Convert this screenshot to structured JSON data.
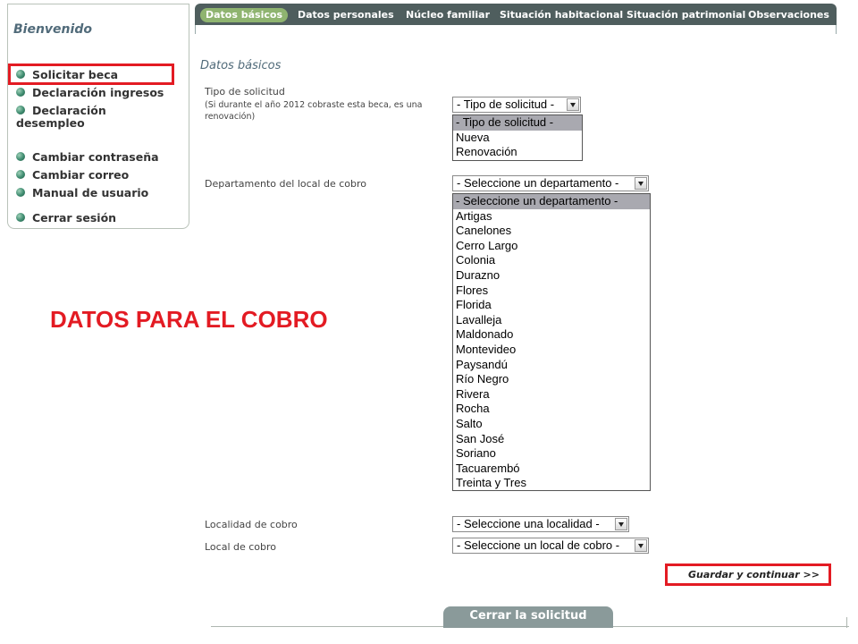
{
  "sidebar": {
    "title": "Bienvenido",
    "items": [
      {
        "label": "Solicitar beca"
      },
      {
        "label": "Declaración ingresos"
      },
      {
        "label": "Declaración desempleo"
      },
      {
        "label": "Cambiar contraseña"
      },
      {
        "label": "Cambiar correo"
      },
      {
        "label": "Manual de usuario"
      },
      {
        "label": "Cerrar sesión"
      }
    ]
  },
  "tabs": [
    {
      "label": "Datos básicos",
      "active": true
    },
    {
      "label": "Datos personales"
    },
    {
      "label": "Núcleo familiar"
    },
    {
      "label": "Situación habitacional"
    },
    {
      "label": "Situación patrimonial"
    },
    {
      "label": "Observaciones"
    }
  ],
  "form": {
    "section_title": "Datos básicos",
    "tipo": {
      "label": "Tipo de solicitud",
      "hint": "(Si durante el año 2012 cobraste esta beca, es una renovación)",
      "selected": "- Tipo de solicitud -",
      "options": [
        "- Tipo de solicitud -",
        "Nueva",
        "Renovación"
      ]
    },
    "departamento": {
      "label": "Departamento del local de cobro",
      "selected": "- Seleccione un departamento -",
      "options": [
        "- Seleccione un departamento -",
        "Artigas",
        "Canelones",
        "Cerro Largo",
        "Colonia",
        "Durazno",
        "Flores",
        "Florida",
        "Lavalleja",
        "Maldonado",
        "Montevideo",
        "Paysandú",
        "Río Negro",
        "Rivera",
        "Rocha",
        "Salto",
        "San José",
        "Soriano",
        "Tacuarembó",
        "Treinta y Tres"
      ]
    },
    "localidad": {
      "label": "Localidad de cobro",
      "selected": "- Seleccione una localidad -"
    },
    "local": {
      "label": "Local de cobro",
      "selected": "- Seleccione un local de cobro -"
    },
    "save_label": "Guardar y continuar >>",
    "close_label": "Cerrar la solicitud"
  },
  "annotation": {
    "title": "DATOS PARA EL COBRO",
    "color": "#e31b23"
  }
}
